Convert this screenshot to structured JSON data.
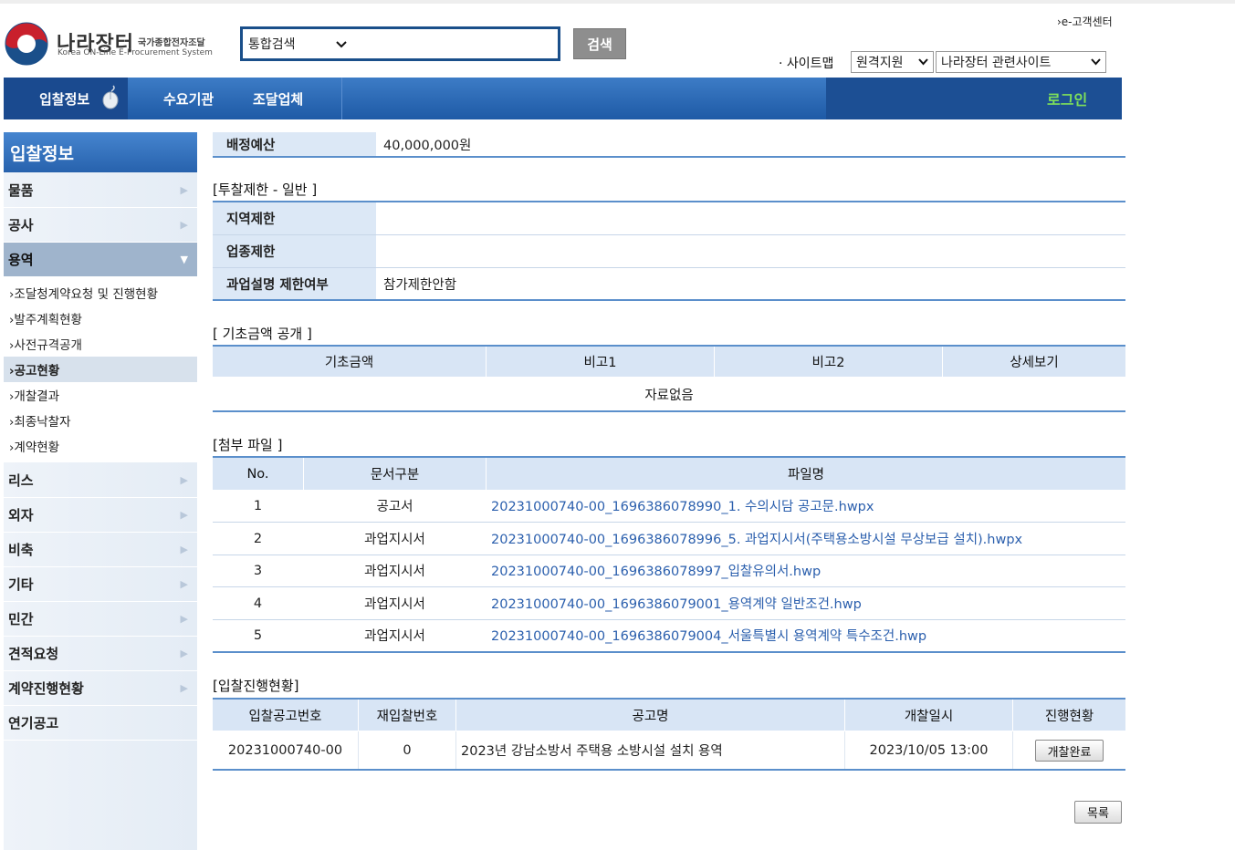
{
  "header": {
    "brand_kr": "나라장터",
    "brand_sub": "국가종합전자조달",
    "brand_en": "Korea ON-Line E-Procurement System",
    "search_scope": "통합검색",
    "search_button": "검색",
    "help_link": "›e-고객센터",
    "sitemap": "· 사이트맵",
    "remote_select": "원격지원",
    "related_select": "나라장터 관련사이트"
  },
  "nav": {
    "items": [
      "입찰정보",
      "수요기관",
      "조달업체"
    ],
    "login": "로그인"
  },
  "sidebar": {
    "title": "입찰정보",
    "items": [
      "물품",
      "공사",
      "용역",
      "리스",
      "외자",
      "비축",
      "기타",
      "민간",
      "견적요청",
      "계약진행현황",
      "연기공고"
    ],
    "subitems": [
      "›조달청계약요청 및 진행현황",
      "›발주계획현황",
      "›사전규격공개",
      "›공고현황",
      "›개찰결과",
      "›최종낙찰자",
      "›계약현황"
    ]
  },
  "budget": {
    "label": "배정예산",
    "value": "40,000,000원"
  },
  "restriction": {
    "title": "[투찰제한 - 일반 ]",
    "rows": [
      {
        "label": "지역제한",
        "value": ""
      },
      {
        "label": "업종제한",
        "value": ""
      },
      {
        "label": "과업설명 제한여부",
        "value": "참가제한안함"
      }
    ]
  },
  "base_amount": {
    "title": "[ 기초금액 공개 ]",
    "headers": [
      "기초금액",
      "비고1",
      "비고2",
      "상세보기"
    ],
    "empty_text": "자료없음"
  },
  "attachments": {
    "title": "[첨부 파일 ]",
    "headers": [
      "No.",
      "문서구분",
      "파일명"
    ],
    "rows": [
      {
        "no": "1",
        "type": "공고서",
        "file": "20231000740-00_1696386078990_1. 수의시담 공고문.hwpx"
      },
      {
        "no": "2",
        "type": "과업지시서",
        "file": "20231000740-00_1696386078996_5. 과업지시서(주택용소방시설 무상보급 설치).hwpx"
      },
      {
        "no": "3",
        "type": "과업지시서",
        "file": "20231000740-00_1696386078997_입찰유의서.hwp"
      },
      {
        "no": "4",
        "type": "과업지시서",
        "file": "20231000740-00_1696386079001_용역계약 일반조건.hwp"
      },
      {
        "no": "5",
        "type": "과업지시서",
        "file": "20231000740-00_1696386079004_서울특별시 용역계약 특수조건.hwp"
      }
    ]
  },
  "progress": {
    "title": "[입찰진행현황]",
    "headers": [
      "입찰공고번호",
      "재입찰번호",
      "공고명",
      "개찰일시",
      "진행현황"
    ],
    "row": {
      "notice_no": "20231000740-00",
      "rebid_no": "0",
      "notice_name": "2023년 강남소방서 주택용 소방시설 설치 용역",
      "open_date": "2023/10/05 13:00",
      "status_button": "개찰완료"
    }
  },
  "list_button": "목록",
  "colors": {
    "nav": "#2b6cbb",
    "login": "#7ee05a",
    "link": "#2b5fad",
    "header_cell": "#d8e5f5"
  }
}
